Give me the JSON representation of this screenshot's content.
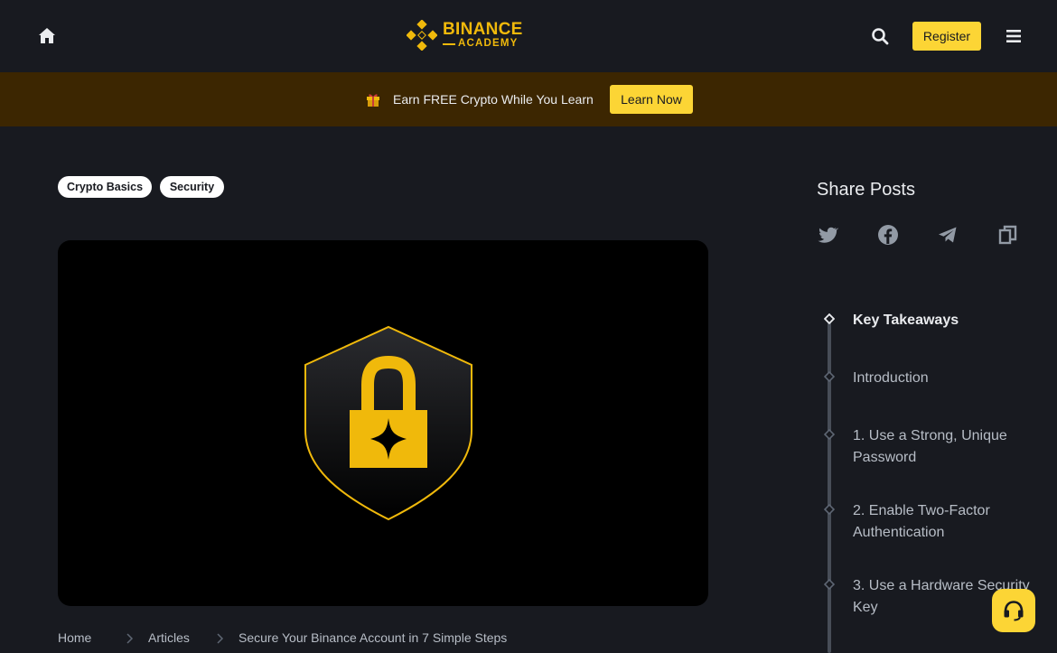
{
  "header": {
    "logo_main": "BINANCE",
    "logo_sub": "ACADEMY",
    "register_label": "Register"
  },
  "promo": {
    "text": "Earn FREE Crypto While You Learn",
    "cta_label": "Learn Now"
  },
  "tags": [
    "Crypto Basics",
    "Security"
  ],
  "breadcrumb": [
    "Home",
    "Articles",
    "Secure Your Binance Account in 7 Simple Steps"
  ],
  "share": {
    "title": "Share Posts",
    "icons": [
      "twitter-icon",
      "facebook-icon",
      "telegram-icon",
      "copy-link-icon"
    ]
  },
  "toc": {
    "items": [
      "Key Takeaways",
      "Introduction",
      "1. Use a Strong, Unique Password",
      "2. Enable Two-Factor Authentication",
      "3. Use a Hardware Security Key"
    ],
    "active_index": 0
  },
  "colors": {
    "brand_yellow": "#fcd535",
    "logo_gold": "#f0b90b",
    "background": "#181a20",
    "banner": "#3c2601"
  }
}
